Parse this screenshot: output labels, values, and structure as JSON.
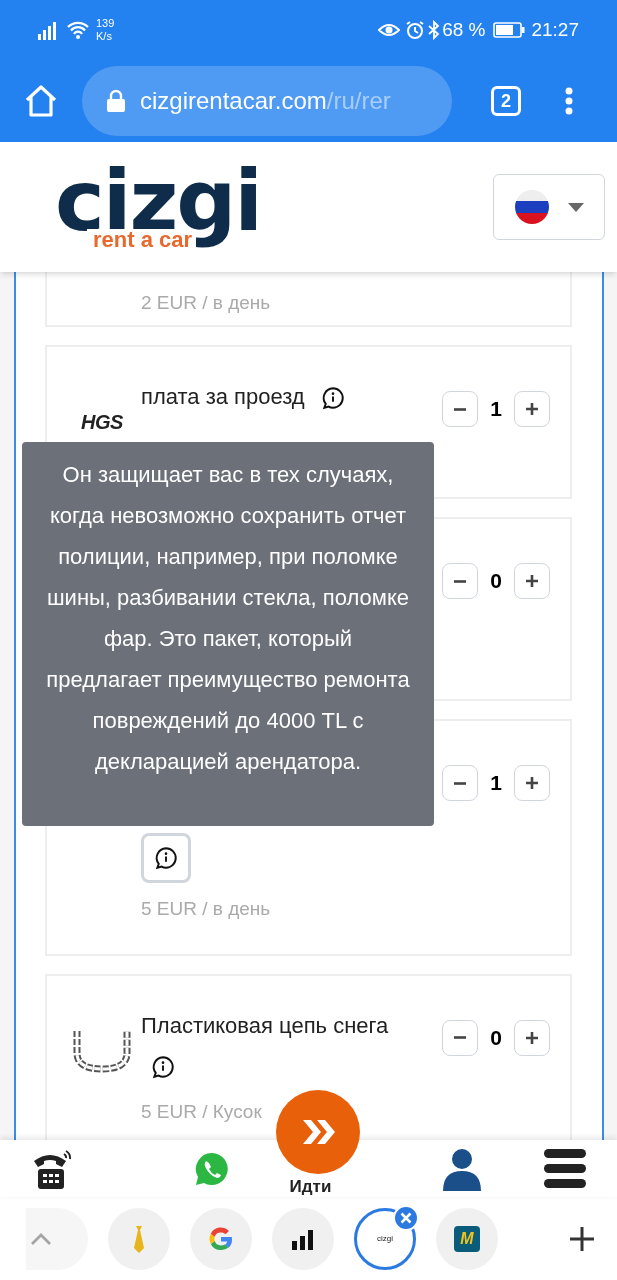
{
  "status_bar": {
    "net_speed": "139",
    "net_unit": "K/s",
    "battery": "68 %",
    "time": "21:27"
  },
  "browser": {
    "url_host": "cizgirentacar.com",
    "url_path": "/ru/rer",
    "tab_count": "2"
  },
  "header": {
    "logo_text": "cizgi",
    "logo_tagline": "rent a car"
  },
  "extras": [
    {
      "kind": "partial",
      "price": "2 EUR / в день"
    },
    {
      "kind": "hgs",
      "icon_label": "HGS",
      "name": "плата за проезд",
      "info_focused": false,
      "quantity": "1"
    },
    {
      "kind": "insurance",
      "quantity": "0"
    },
    {
      "kind": "insurance",
      "info_focused": true,
      "price": "5 EUR / в день",
      "quantity": "1"
    },
    {
      "kind": "chain",
      "name": "Пластиковая цепь снега",
      "info_focused": false,
      "price": "5 EUR / Кусок",
      "quantity": "0"
    }
  ],
  "tooltip": "Он защищает вас в тех случаях, когда невозможно сохранить отчет полиции, например, при поломке шины, разбивании стекла, поломке фар. Это пакет, который предлагает преимущество ремонта повреждений до 4000 TL с декларацией арендатора.",
  "bottom_nav": [
    {
      "kind": "phone"
    },
    {
      "kind": "whatsapp"
    },
    {
      "kind": "go",
      "label": "Идти"
    },
    {
      "kind": "account"
    },
    {
      "kind": "menu"
    }
  ],
  "browser_tabs": [
    {
      "kind": "faded",
      "selected": false
    },
    {
      "kind": "tie",
      "selected": false
    },
    {
      "kind": "google",
      "selected": false
    },
    {
      "kind": "bars",
      "selected": false
    },
    {
      "kind": "site",
      "label": "cizgi",
      "selected": true
    },
    {
      "kind": "m",
      "label": "M",
      "selected": false
    }
  ]
}
